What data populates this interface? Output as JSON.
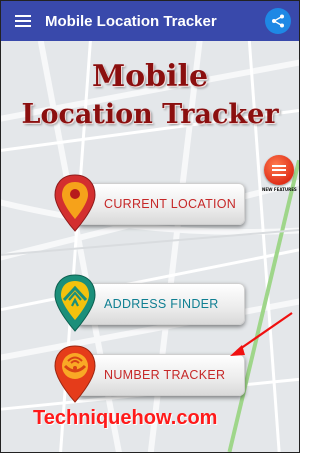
{
  "app_bar": {
    "title": "Mobile Location Tracker",
    "menu_icon": "hamburger-menu-icon",
    "share_icon": "share-icon",
    "color": "#3949ab"
  },
  "heading": {
    "line1": "Mobile",
    "line2": "Location Tracker",
    "color": "#8b0f0f"
  },
  "new_features": {
    "label": "NEW FEATURES",
    "icon": "list-icon"
  },
  "features": [
    {
      "label": "CURRENT LOCATION",
      "icon": "location-pin-icon"
    },
    {
      "label": "ADDRESS FINDER",
      "icon": "address-house-icon"
    },
    {
      "label": "NUMBER TRACKER",
      "icon": "phone-tracker-icon"
    }
  ],
  "watermark": "Techniquehow.com"
}
